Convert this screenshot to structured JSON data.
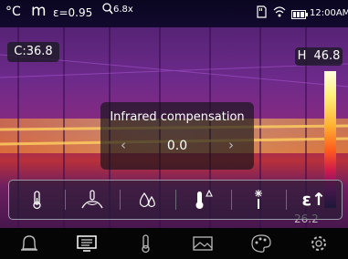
{
  "status": {
    "unit": "°C",
    "unit_icon": "m",
    "emissivity": "ε=0.95",
    "zoom": "6.8x",
    "time": "12:00AM"
  },
  "measure": {
    "center": "C:36.8",
    "high_label": "H",
    "high": "46.8",
    "low": "26.2"
  },
  "popup": {
    "title": "Infrared compensation",
    "value": "0.0",
    "left": "‹",
    "right": "›"
  },
  "icon_bar": {
    "items": [
      "thermometer-icon",
      "hand-temperature-icon",
      "humidity-drops-icon",
      "thermometer-alarm-icon",
      "laser-spark-icon",
      "emissivity-icon"
    ],
    "emissivity_symbol": "ε↑"
  },
  "menu_bar": {
    "items": [
      "bell-icon",
      "display-icon",
      "thermometer-icon",
      "image-icon",
      "palette-icon",
      "settings-icon"
    ],
    "selected": "display-icon"
  },
  "colors": {
    "accent": "#ffffff",
    "scale_top": "#fffde0",
    "scale_bottom": "#20104a"
  }
}
